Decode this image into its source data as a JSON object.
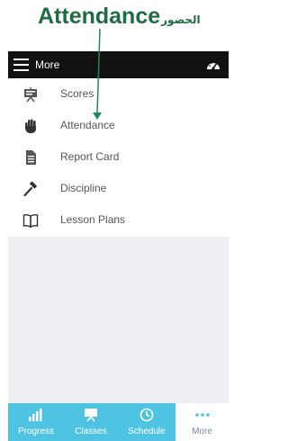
{
  "annotation": {
    "english": "Attendance",
    "arabic": "الحضور",
    "color": "#1f6b43"
  },
  "topbar": {
    "menu_icon": "hamburger-menu-icon",
    "title": "More",
    "right_icon": "gauge-icon"
  },
  "menu": {
    "items": [
      {
        "label": "Scores",
        "icon": "presentation-board-icon"
      },
      {
        "label": "Attendance",
        "icon": "hand-icon"
      },
      {
        "label": "Report Card",
        "icon": "document-icon"
      },
      {
        "label": "Discipline",
        "icon": "gavel-icon"
      },
      {
        "label": "Lesson Plans",
        "icon": "open-book-icon"
      }
    ]
  },
  "tabbar": {
    "tabs": [
      {
        "label": "Progress",
        "icon": "progress-chart-icon",
        "active": false
      },
      {
        "label": "Classes",
        "icon": "classes-board-icon",
        "active": false
      },
      {
        "label": "Schedule",
        "icon": "clock-icon",
        "active": false
      },
      {
        "label": "More",
        "icon": "more-dots-icon",
        "active": true
      }
    ],
    "color": "#4fc3e2"
  }
}
